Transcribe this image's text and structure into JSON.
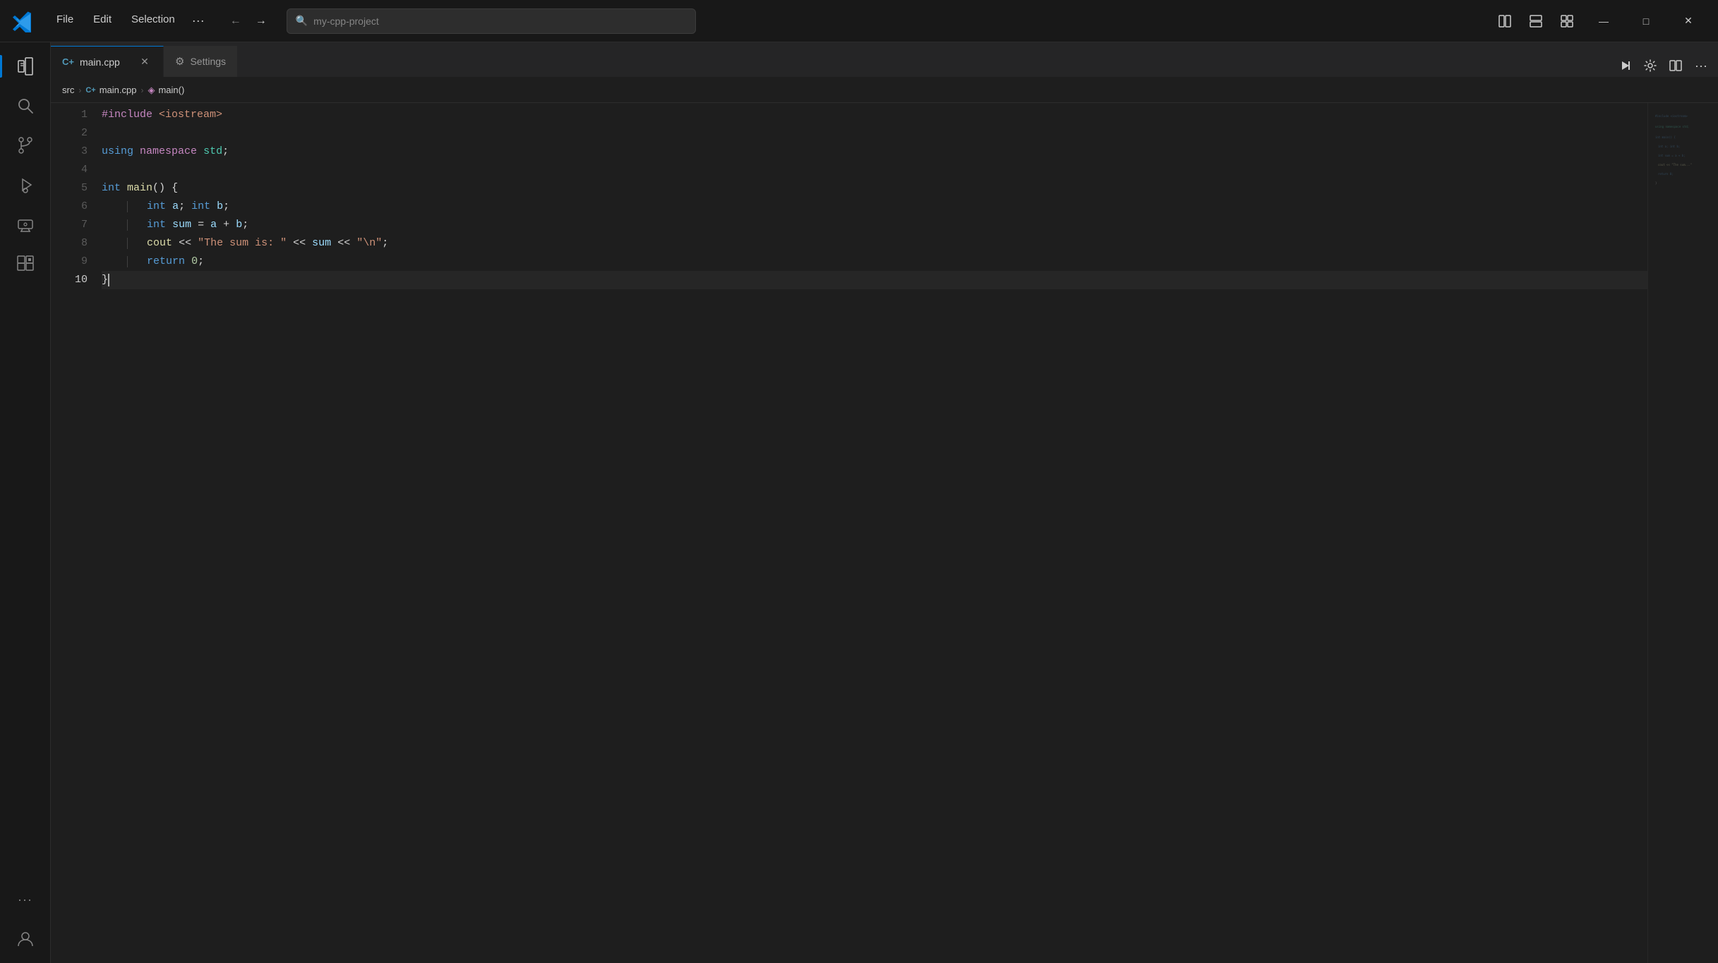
{
  "titlebar": {
    "menu_items": [
      "File",
      "Edit",
      "Selection"
    ],
    "more_label": "···",
    "back_label": "←",
    "forward_label": "→",
    "search_text": "my-cpp-project",
    "search_icon": "🔍",
    "layout_icons": [
      "▣",
      "▤",
      "⧉",
      "▦"
    ],
    "minimize_label": "—",
    "maximize_label": "□",
    "close_label": "✕"
  },
  "activity_bar": {
    "items": [
      {
        "name": "explorer",
        "icon": "⧉",
        "active": true
      },
      {
        "name": "search",
        "icon": "🔍",
        "active": false
      },
      {
        "name": "source-control",
        "icon": "⑂",
        "active": false
      },
      {
        "name": "run-debug",
        "icon": "▷",
        "active": false
      },
      {
        "name": "remote-explorer",
        "icon": "⊡",
        "active": false
      },
      {
        "name": "extensions",
        "icon": "⊞",
        "active": false
      }
    ],
    "bottom_items": [
      {
        "name": "more",
        "icon": "···"
      }
    ],
    "account_icon": "👤"
  },
  "tabs": {
    "main_tab": {
      "icon": "C+",
      "label": "main.cpp",
      "close": "✕",
      "active": true
    },
    "settings_tab": {
      "icon": "⚙",
      "label": "Settings",
      "active": false
    }
  },
  "tab_actions": {
    "run_split_label": "▷",
    "gear_label": "⚙",
    "split_label": "⧉",
    "more_label": "···"
  },
  "breadcrumb": {
    "src": "src",
    "sep1": "›",
    "file_icon": "C+",
    "file": "main.cpp",
    "sep2": "›",
    "func_icon": "◈",
    "func": "main()"
  },
  "code": {
    "lines": [
      {
        "num": 1,
        "content": "#include <iostream>"
      },
      {
        "num": 2,
        "content": ""
      },
      {
        "num": 3,
        "content": "using namespace std;"
      },
      {
        "num": 4,
        "content": ""
      },
      {
        "num": 5,
        "content": "int main() {"
      },
      {
        "num": 6,
        "content": "    int a; int b;"
      },
      {
        "num": 7,
        "content": "    int sum = a + b;"
      },
      {
        "num": 8,
        "content": "    cout << \"The sum is: \" << sum << \"\\n\";"
      },
      {
        "num": 9,
        "content": "    return 0;"
      },
      {
        "num": 10,
        "content": "}"
      }
    ]
  }
}
